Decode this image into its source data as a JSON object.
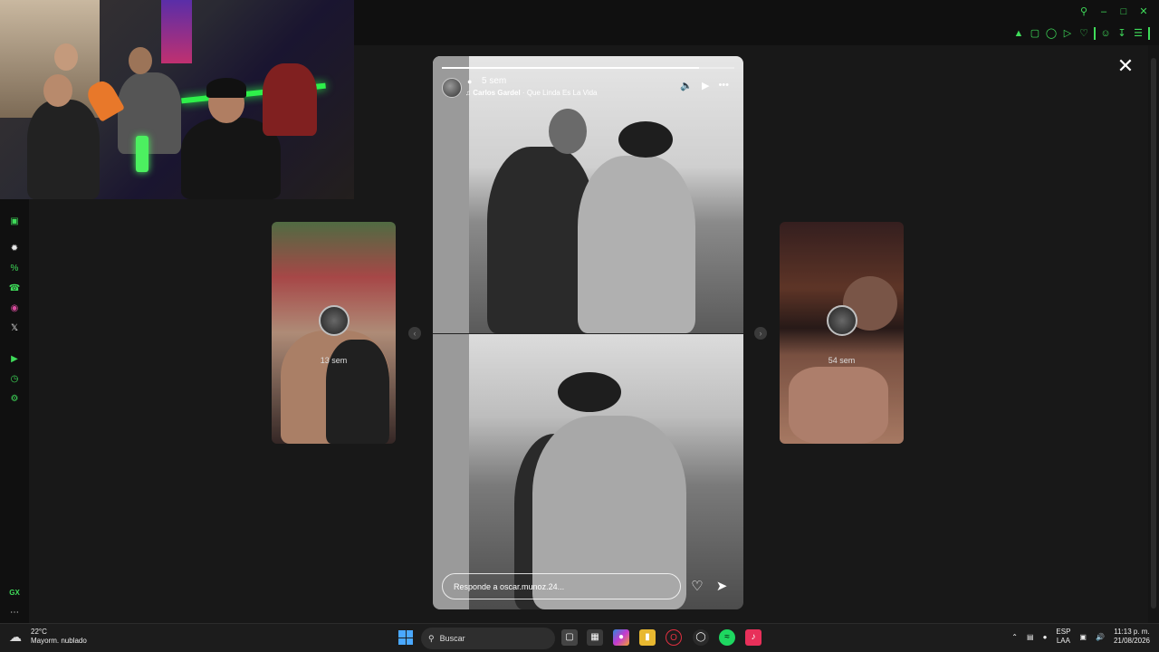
{
  "story": {
    "time_ago": "5 sem",
    "song_artist": "Carlos Gardel",
    "song_title": "Que Linda Es La Vida",
    "reply_placeholder": "Responde a oscar.munoz.24..."
  },
  "prev_story": {
    "time_ago": "13 sem"
  },
  "next_story": {
    "time_ago": "54 sem"
  },
  "taskbar": {
    "weather_temp": "22°C",
    "weather_desc": "Mayorm. nublado",
    "search_label": "Buscar",
    "lang_top": "ESP",
    "lang_bottom": "LAA",
    "time": "11:13 p. m.",
    "date": "21/08/2026"
  },
  "sidebar_label": "GX",
  "icons": {
    "close": "close-icon",
    "mute": "speaker-icon",
    "play": "play-icon",
    "more": "more-icon",
    "heart": "heart-icon",
    "send": "send-icon"
  },
  "colors": {
    "accent": "#3fdc5a",
    "background": "#181818"
  }
}
